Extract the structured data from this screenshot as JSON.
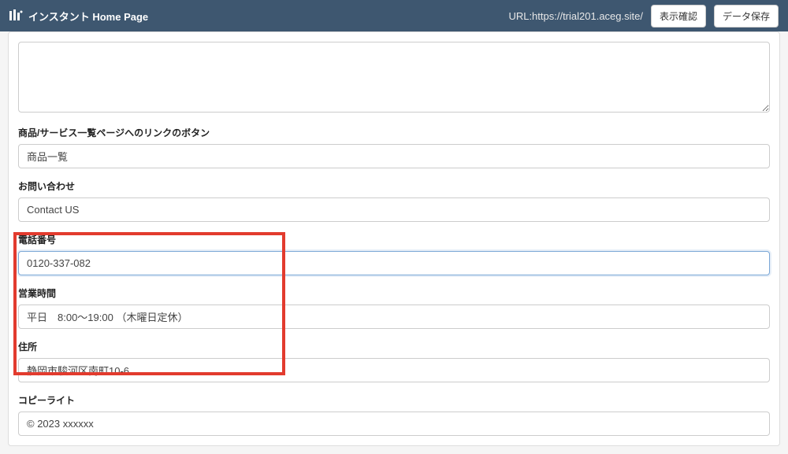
{
  "header": {
    "title": "インスタント Home Page",
    "url_label": "URL:https://trial201.aceg.site/",
    "preview_button": "表示確認",
    "save_button": "データ保存"
  },
  "form": {
    "top_textarea": "",
    "link_button": {
      "label": "商品/サービス一覧ページへのリンクのボタン",
      "value": "商品一覧"
    },
    "contact": {
      "label": "お問い合わせ",
      "value": "Contact US"
    },
    "phone": {
      "label": "電話番号",
      "value": "0120-337-082"
    },
    "hours": {
      "label": "営業時間",
      "value": "平日　8:00～19:00 （木曜日定休）"
    },
    "address": {
      "label": "住所",
      "value": "静岡市駿河区南町10-6"
    },
    "copyright": {
      "label": "コピーライト",
      "value": "© 2023 xxxxxx"
    }
  }
}
